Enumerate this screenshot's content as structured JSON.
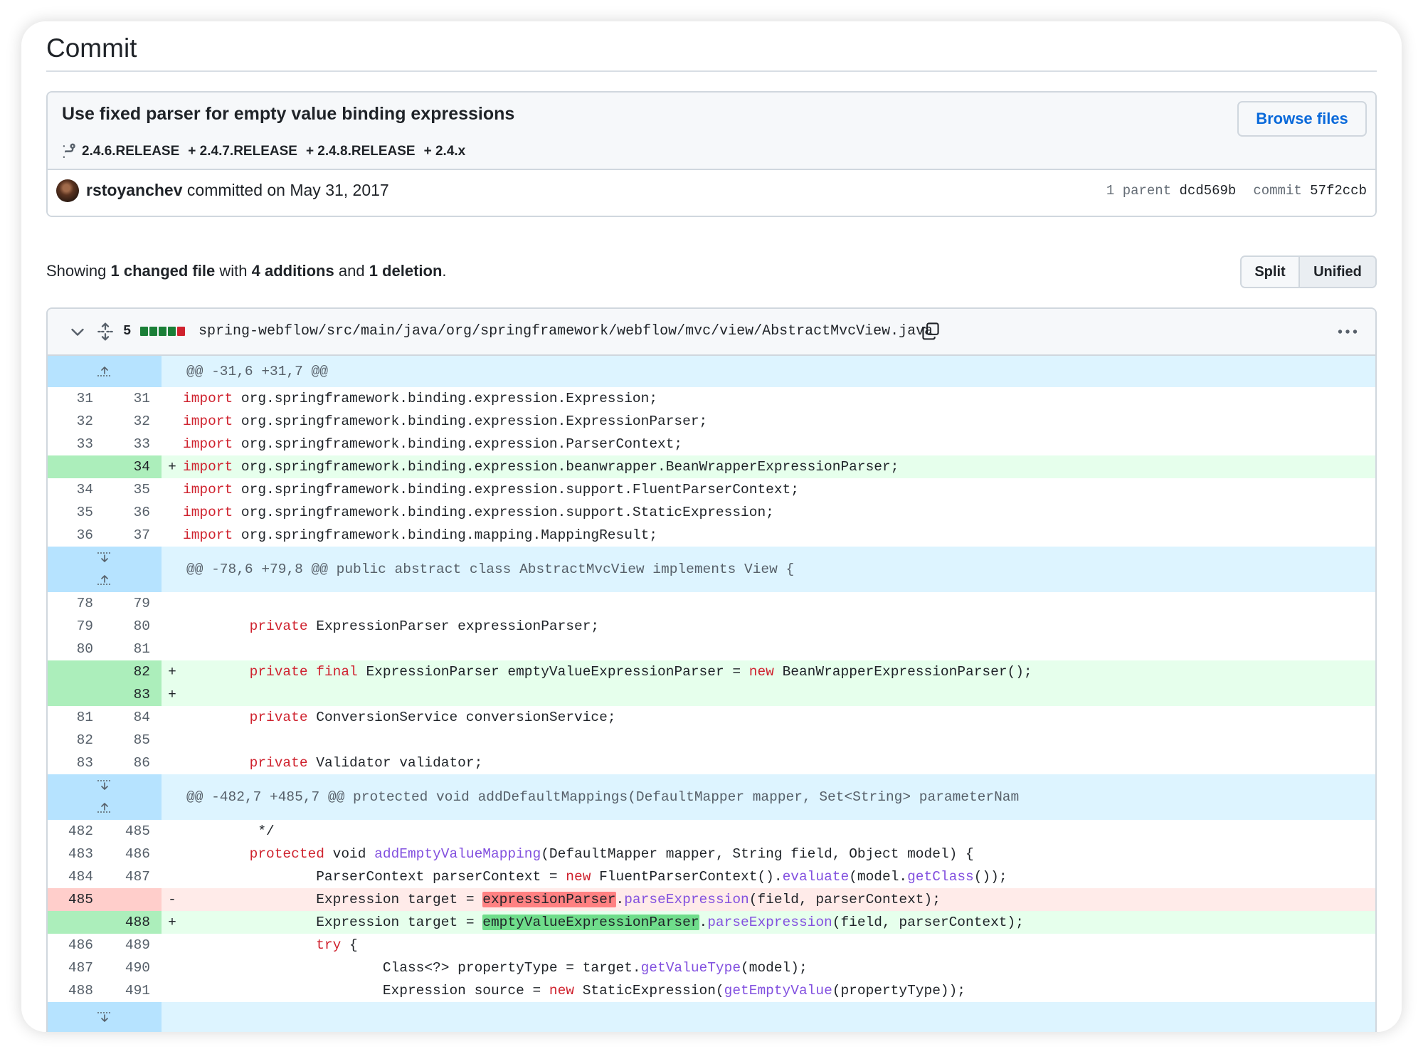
{
  "page_title": "Commit",
  "commit": {
    "message": "Use fixed parser for empty value binding expressions",
    "branches": [
      "2.4.6.RELEASE",
      "+ 2.4.7.RELEASE",
      "+ 2.4.8.RELEASE",
      "+ 2.4.x"
    ],
    "browse_label": "Browse files",
    "author": "rstoyanchev",
    "committed_text": "committed on May 31, 2017",
    "parent_label": "1 parent",
    "parent_sha": "dcd569b",
    "commit_label": "commit",
    "commit_sha": "57f2ccb"
  },
  "summary": {
    "prefix": "Showing",
    "changed": "1 changed file",
    "with": "with",
    "additions": "4 additions",
    "and": "and",
    "deletions": "1 deletion",
    "suffix": "."
  },
  "view_toggle": {
    "split": "Split",
    "unified": "Unified",
    "selected": "Unified"
  },
  "file": {
    "change_count": "5",
    "path": "spring-webflow/src/main/java/org/springframework/webflow/mvc/view/AbstractMvcView.java",
    "bar_colors": [
      "#1a7f37",
      "#1a7f37",
      "#1a7f37",
      "#1a7f37",
      "#cf222e"
    ],
    "hunks": [
      "@@ -31,6 +31,7 @@",
      "@@ -78,6 +79,8 @@ public abstract class AbstractMvcView implements View {",
      "@@ -482,7 +485,7 @@ protected void addDefaultMappings(DefaultMapper mapper, Set<String> parameterNam"
    ],
    "lines": [
      {
        "old": "31",
        "new": "31",
        "mark": "",
        "type": "ctx",
        "code": "import org.springframework.binding.expression.Expression;"
      },
      {
        "old": "32",
        "new": "32",
        "mark": "",
        "type": "ctx",
        "code": "import org.springframework.binding.expression.ExpressionParser;"
      },
      {
        "old": "33",
        "new": "33",
        "mark": "",
        "type": "ctx",
        "code": "import org.springframework.binding.expression.ParserContext;"
      },
      {
        "old": "",
        "new": "34",
        "mark": "+",
        "type": "add",
        "code": "import org.springframework.binding.expression.beanwrapper.BeanWrapperExpressionParser;"
      },
      {
        "old": "34",
        "new": "35",
        "mark": "",
        "type": "ctx",
        "code": "import org.springframework.binding.expression.support.FluentParserContext;"
      },
      {
        "old": "35",
        "new": "36",
        "mark": "",
        "type": "ctx",
        "code": "import org.springframework.binding.expression.support.StaticExpression;"
      },
      {
        "old": "36",
        "new": "37",
        "mark": "",
        "type": "ctx",
        "code": "import org.springframework.binding.mapping.MappingResult;"
      },
      {
        "old": "78",
        "new": "79",
        "mark": "",
        "type": "ctx",
        "code": ""
      },
      {
        "old": "79",
        "new": "80",
        "mark": "",
        "type": "ctx",
        "code": "private ExpressionParser expressionParser;"
      },
      {
        "old": "80",
        "new": "81",
        "mark": "",
        "type": "ctx",
        "code": ""
      },
      {
        "old": "",
        "new": "82",
        "mark": "+",
        "type": "add",
        "code": "private final ExpressionParser emptyValueExpressionParser = new BeanWrapperExpressionParser();"
      },
      {
        "old": "",
        "new": "83",
        "mark": "+",
        "type": "add",
        "code": ""
      },
      {
        "old": "81",
        "new": "84",
        "mark": "",
        "type": "ctx",
        "code": "private ConversionService conversionService;"
      },
      {
        "old": "82",
        "new": "85",
        "mark": "",
        "type": "ctx",
        "code": ""
      },
      {
        "old": "83",
        "new": "86",
        "mark": "",
        "type": "ctx",
        "code": "private Validator validator;"
      },
      {
        "old": "482",
        "new": "485",
        "mark": "",
        "type": "ctx",
        "code": " */"
      },
      {
        "old": "483",
        "new": "486",
        "mark": "",
        "type": "ctx",
        "code": "protected void addEmptyValueMapping(DefaultMapper mapper, String field, Object model) {"
      },
      {
        "old": "484",
        "new": "487",
        "mark": "",
        "type": "ctx",
        "code": "ParserContext parserContext = new FluentParserContext().evaluate(model.getClass());"
      },
      {
        "old": "485",
        "new": "",
        "mark": "-",
        "type": "del",
        "code": "Expression target = expressionParser.parseExpression(field, parserContext);"
      },
      {
        "old": "",
        "new": "488",
        "mark": "+",
        "type": "add",
        "code": "Expression target = emptyValueExpressionParser.parseExpression(field, parserContext);"
      },
      {
        "old": "486",
        "new": "489",
        "mark": "",
        "type": "ctx",
        "code": "try {"
      },
      {
        "old": "487",
        "new": "490",
        "mark": "",
        "type": "ctx",
        "code": "Class<?> propertyType = target.getValueType(model);"
      },
      {
        "old": "488",
        "new": "491",
        "mark": "",
        "type": "ctx",
        "code": "Expression source = new StaticExpression(getEmptyValue(propertyType));"
      }
    ]
  }
}
